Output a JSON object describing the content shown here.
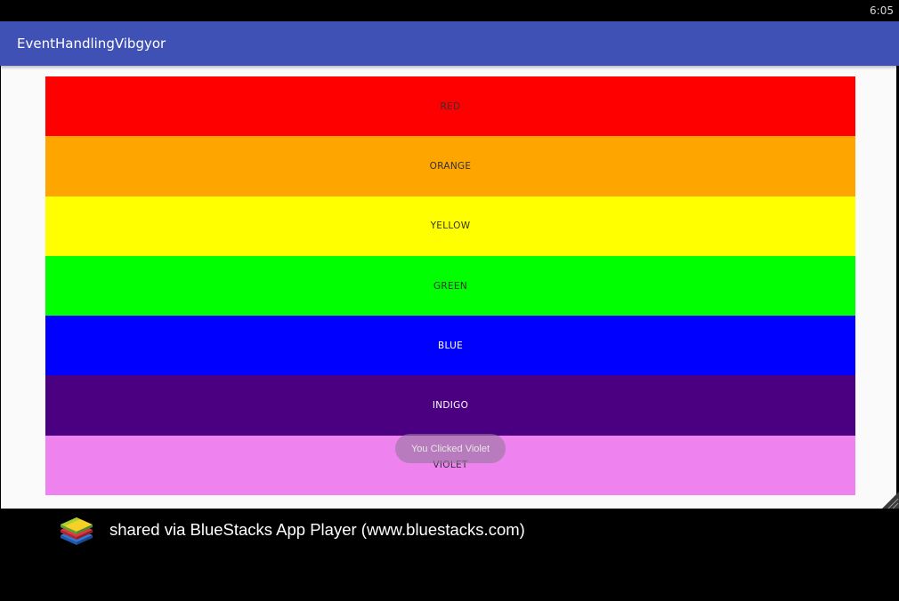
{
  "status_bar": {
    "time": "6:05"
  },
  "app_bar": {
    "title": "EventHandlingVibgyor",
    "color": "#3f51b5"
  },
  "color_buttons": [
    {
      "label": "RED",
      "color": "#ff0000",
      "text_color": "#333333"
    },
    {
      "label": "ORANGE",
      "color": "#ffa500",
      "text_color": "#333333"
    },
    {
      "label": "YELLOW",
      "color": "#ffff00",
      "text_color": "#333333"
    },
    {
      "label": "GREEN",
      "color": "#00ff00",
      "text_color": "#333333"
    },
    {
      "label": "BLUE",
      "color": "#0000ff",
      "text_color": "#ffffff"
    },
    {
      "label": "INDIGO",
      "color": "#4b0082",
      "text_color": "#ffffff"
    },
    {
      "label": "VIOLET",
      "color": "#ee82ee",
      "text_color": "#333333"
    }
  ],
  "toast": {
    "message": "You Clicked Violet"
  },
  "footer": {
    "logo_icon": "bluestacks-logo-icon",
    "text": "shared via BlueStacks App Player (www.bluestacks.com)"
  }
}
